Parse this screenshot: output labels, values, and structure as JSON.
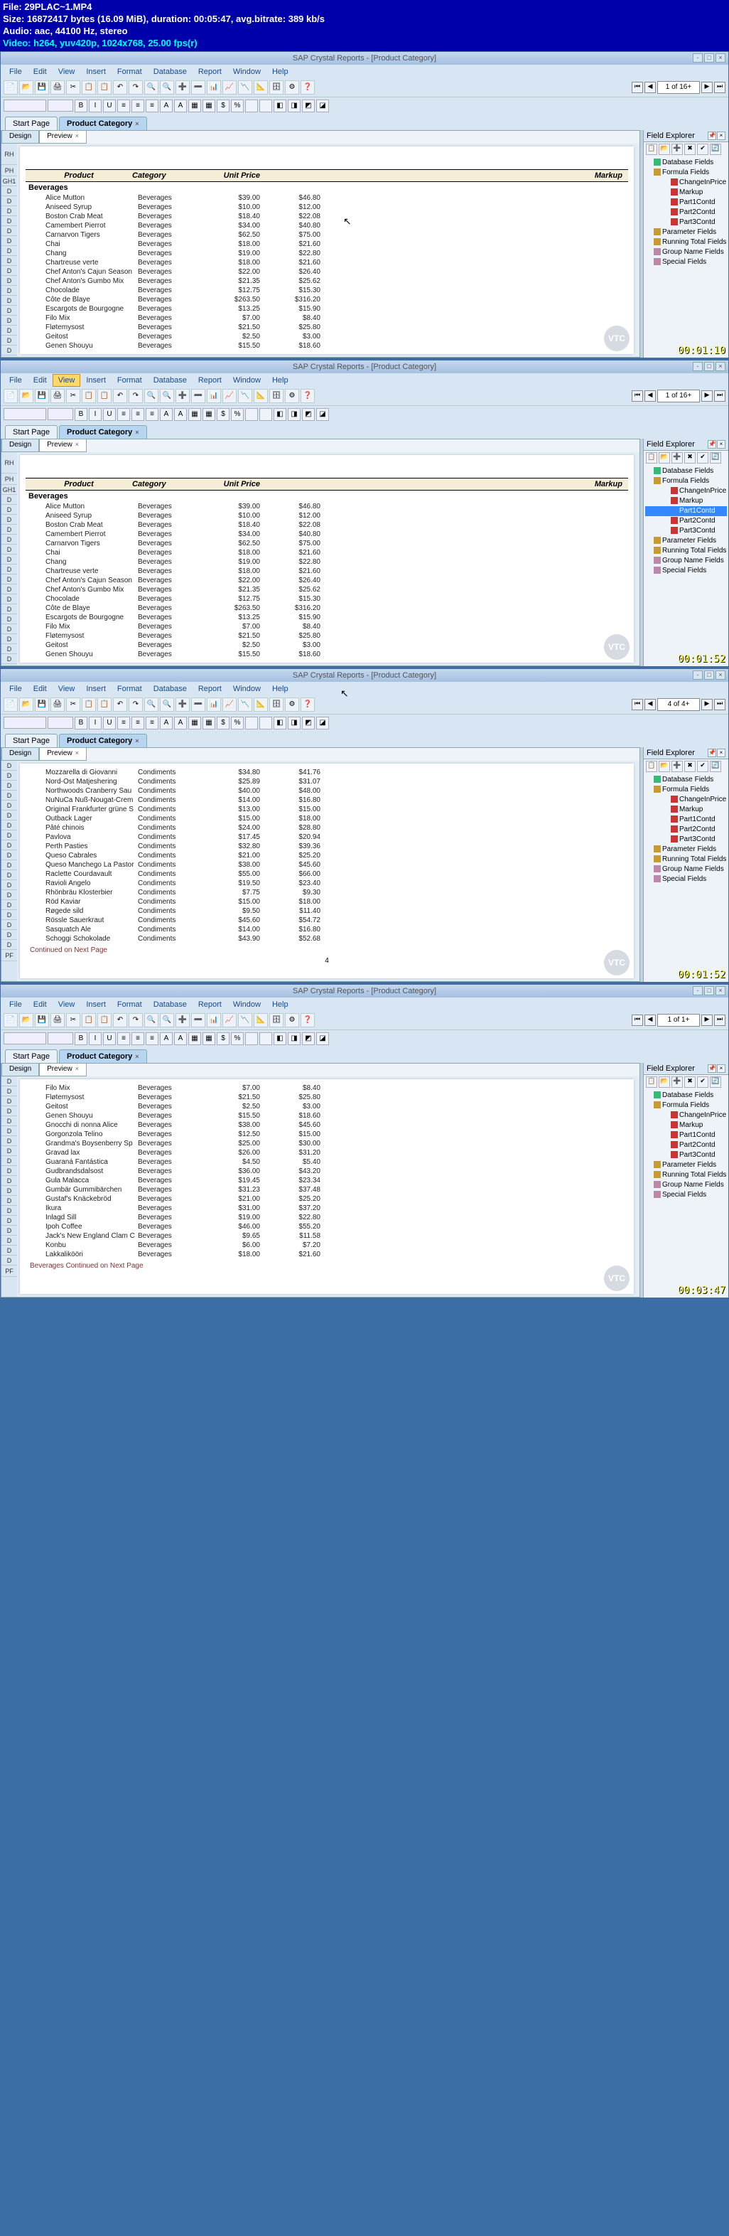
{
  "video": {
    "l1": "File: 29PLAC~1.MP4",
    "l2": "Size: 16872417 bytes (16.09 MiB), duration: 00:05:47, avg.bitrate: 389 kb/s",
    "l3": "Audio: aac, 44100 Hz, stereo",
    "l4": "Video: h264, yuv420p, 1024x768, 25.00 fps(r)"
  },
  "app_title": "SAP Crystal Reports - [Product Category]",
  "menu": {
    "file": "File",
    "edit": "Edit",
    "view": "View",
    "insert": "Insert",
    "format": "Format",
    "database": "Database",
    "report": "Report",
    "window": "Window",
    "help": "Help"
  },
  "tabs": {
    "start": "Start Page",
    "product": "Product Category"
  },
  "subtabs": {
    "design": "Design",
    "preview": "Preview"
  },
  "page_ind": {
    "f1": "1 of 16+",
    "f2": "1 of 16+",
    "f3": "4 of 4+",
    "f4": "1 of 1+"
  },
  "explorer": {
    "title": "Field Explorer",
    "nodes": {
      "db": "Database Fields",
      "formula": "Formula Fields",
      "f_change": "ChangeInPrice",
      "f_markup": "Markup",
      "f_p1": "Part1Contd",
      "f_p2": "Part2Contd",
      "f_p3": "Part3Contd",
      "param": "Parameter Fields",
      "running": "Running Total Fields",
      "group": "Group Name Fields",
      "special": "Special Fields"
    }
  },
  "report_headers": {
    "product": "Product",
    "category": "Category",
    "unitprice": "Unit Price",
    "markup": "Markup"
  },
  "gutter": {
    "rh": "RH",
    "ph": "PH",
    "gh1": "GH1",
    "d": "D",
    "pf": "PF"
  },
  "frame1": {
    "group": "Beverages",
    "rows": [
      {
        "p": "Alice Mutton",
        "c": "Beverages",
        "u": "$39.00",
        "m": "$46.80"
      },
      {
        "p": "Aniseed Syrup",
        "c": "Beverages",
        "u": "$10.00",
        "m": "$12.00"
      },
      {
        "p": "Boston Crab Meat",
        "c": "Beverages",
        "u": "$18.40",
        "m": "$22.08"
      },
      {
        "p": "Camembert Pierrot",
        "c": "Beverages",
        "u": "$34.00",
        "m": "$40.80"
      },
      {
        "p": "Carnarvon Tigers",
        "c": "Beverages",
        "u": "$62.50",
        "m": "$75.00"
      },
      {
        "p": "Chai",
        "c": "Beverages",
        "u": "$18.00",
        "m": "$21.60"
      },
      {
        "p": "Chang",
        "c": "Beverages",
        "u": "$19.00",
        "m": "$22.80"
      },
      {
        "p": "Chartreuse verte",
        "c": "Beverages",
        "u": "$18.00",
        "m": "$21.60"
      },
      {
        "p": "Chef Anton's Cajun Season",
        "c": "Beverages",
        "u": "$22.00",
        "m": "$26.40"
      },
      {
        "p": "Chef Anton's Gumbo Mix",
        "c": "Beverages",
        "u": "$21.35",
        "m": "$25.62"
      },
      {
        "p": "Chocolade",
        "c": "Beverages",
        "u": "$12.75",
        "m": "$15.30"
      },
      {
        "p": "Côte de Blaye",
        "c": "Beverages",
        "u": "$263.50",
        "m": "$316.20"
      },
      {
        "p": "Escargots de Bourgogne",
        "c": "Beverages",
        "u": "$13.25",
        "m": "$15.90"
      },
      {
        "p": "Filo Mix",
        "c": "Beverages",
        "u": "$7.00",
        "m": "$8.40"
      },
      {
        "p": "Fløtemysost",
        "c": "Beverages",
        "u": "$21.50",
        "m": "$25.80"
      },
      {
        "p": "Geitost",
        "c": "Beverages",
        "u": "$2.50",
        "m": "$3.00"
      },
      {
        "p": "Genen Shouyu",
        "c": "Beverages",
        "u": "$15.50",
        "m": "$18.60"
      }
    ],
    "timestamp": "00:01:10"
  },
  "frame2": {
    "group": "Beverages",
    "rows": [
      {
        "p": "Alice Mutton",
        "c": "Beverages",
        "u": "$39.00",
        "m": "$46.80"
      },
      {
        "p": "Aniseed Syrup",
        "c": "Beverages",
        "u": "$10.00",
        "m": "$12.00"
      },
      {
        "p": "Boston Crab Meat",
        "c": "Beverages",
        "u": "$18.40",
        "m": "$22.08"
      },
      {
        "p": "Camembert Pierrot",
        "c": "Beverages",
        "u": "$34.00",
        "m": "$40.80"
      },
      {
        "p": "Carnarvon Tigers",
        "c": "Beverages",
        "u": "$62.50",
        "m": "$75.00"
      },
      {
        "p": "Chai",
        "c": "Beverages",
        "u": "$18.00",
        "m": "$21.60"
      },
      {
        "p": "Chang",
        "c": "Beverages",
        "u": "$19.00",
        "m": "$22.80"
      },
      {
        "p": "Chartreuse verte",
        "c": "Beverages",
        "u": "$18.00",
        "m": "$21.60"
      },
      {
        "p": "Chef Anton's Cajun Season",
        "c": "Beverages",
        "u": "$22.00",
        "m": "$26.40"
      },
      {
        "p": "Chef Anton's Gumbo Mix",
        "c": "Beverages",
        "u": "$21.35",
        "m": "$25.62"
      },
      {
        "p": "Chocolade",
        "c": "Beverages",
        "u": "$12.75",
        "m": "$15.30"
      },
      {
        "p": "Côte de Blaye",
        "c": "Beverages",
        "u": "$263.50",
        "m": "$316.20"
      },
      {
        "p": "Escargots de Bourgogne",
        "c": "Beverages",
        "u": "$13.25",
        "m": "$15.90"
      },
      {
        "p": "Filo Mix",
        "c": "Beverages",
        "u": "$7.00",
        "m": "$8.40"
      },
      {
        "p": "Fløtemysost",
        "c": "Beverages",
        "u": "$21.50",
        "m": "$25.80"
      },
      {
        "p": "Geitost",
        "c": "Beverages",
        "u": "$2.50",
        "m": "$3.00"
      },
      {
        "p": "Genen Shouyu",
        "c": "Beverages",
        "u": "$15.50",
        "m": "$18.60"
      }
    ],
    "timestamp": "00:01:52"
  },
  "frame3": {
    "rows": [
      {
        "p": "Mozzarella di Giovanni",
        "c": "Condiments",
        "u": "$34.80",
        "m": "$41.76"
      },
      {
        "p": "Nord-Ost Matjeshering",
        "c": "Condiments",
        "u": "$25.89",
        "m": "$31.07"
      },
      {
        "p": "Northwoods Cranberry Sau",
        "c": "Condiments",
        "u": "$40.00",
        "m": "$48.00"
      },
      {
        "p": "NuNuCa Nuß-Nougat-Crem",
        "c": "Condiments",
        "u": "$14.00",
        "m": "$16.80"
      },
      {
        "p": "Original Frankfurter grüne S",
        "c": "Condiments",
        "u": "$13.00",
        "m": "$15.00"
      },
      {
        "p": "Outback Lager",
        "c": "Condiments",
        "u": "$15.00",
        "m": "$18.00"
      },
      {
        "p": "Pâté chinois",
        "c": "Condiments",
        "u": "$24.00",
        "m": "$28.80"
      },
      {
        "p": "Pavlova",
        "c": "Condiments",
        "u": "$17.45",
        "m": "$20.94"
      },
      {
        "p": "Perth Pasties",
        "c": "Condiments",
        "u": "$32.80",
        "m": "$39.36"
      },
      {
        "p": "Queso Cabrales",
        "c": "Condiments",
        "u": "$21.00",
        "m": "$25.20"
      },
      {
        "p": "Queso Manchego La Pastor",
        "c": "Condiments",
        "u": "$38.00",
        "m": "$45.60"
      },
      {
        "p": "Raclette Courdavault",
        "c": "Condiments",
        "u": "$55.00",
        "m": "$66.00"
      },
      {
        "p": "Ravioli Angelo",
        "c": "Condiments",
        "u": "$19.50",
        "m": "$23.40"
      },
      {
        "p": "Rhönbräu Klosterbier",
        "c": "Condiments",
        "u": "$7.75",
        "m": "$9.30"
      },
      {
        "p": "Röd Kaviar",
        "c": "Condiments",
        "u": "$15.00",
        "m": "$18.00"
      },
      {
        "p": "Røgede sild",
        "c": "Condiments",
        "u": "$9.50",
        "m": "$11.40"
      },
      {
        "p": "Rössle Sauerkraut",
        "c": "Condiments",
        "u": "$45.60",
        "m": "$54.72"
      },
      {
        "p": "Sasquatch Ale",
        "c": "Condiments",
        "u": "$14.00",
        "m": "$16.80"
      },
      {
        "p": "Schoggi Schokolade",
        "c": "Condiments",
        "u": "$43.90",
        "m": "$52.68"
      }
    ],
    "cont": "Continued on Next Page",
    "page_num": "4",
    "timestamp": "00:01:52"
  },
  "frame4": {
    "rows": [
      {
        "p": "Filo Mix",
        "c": "Beverages",
        "u": "$7.00",
        "m": "$8.40"
      },
      {
        "p": "Fløtemysost",
        "c": "Beverages",
        "u": "$21.50",
        "m": "$25.80"
      },
      {
        "p": "Geitost",
        "c": "Beverages",
        "u": "$2.50",
        "m": "$3.00"
      },
      {
        "p": "Genen Shouyu",
        "c": "Beverages",
        "u": "$15.50",
        "m": "$18.60"
      },
      {
        "p": "Gnocchi di nonna Alice",
        "c": "Beverages",
        "u": "$38.00",
        "m": "$45.60"
      },
      {
        "p": "Gorgonzola Telino",
        "c": "Beverages",
        "u": "$12.50",
        "m": "$15.00"
      },
      {
        "p": "Grandma's Boysenberry Sp",
        "c": "Beverages",
        "u": "$25.00",
        "m": "$30.00"
      },
      {
        "p": "Gravad lax",
        "c": "Beverages",
        "u": "$26.00",
        "m": "$31.20"
      },
      {
        "p": "Guaraná Fantástica",
        "c": "Beverages",
        "u": "$4.50",
        "m": "$5.40"
      },
      {
        "p": "Gudbrandsdalsost",
        "c": "Beverages",
        "u": "$36.00",
        "m": "$43.20"
      },
      {
        "p": "Gula Malacca",
        "c": "Beverages",
        "u": "$19.45",
        "m": "$23.34"
      },
      {
        "p": "Gumbär Gummibärchen",
        "c": "Beverages",
        "u": "$31.23",
        "m": "$37.48"
      },
      {
        "p": "Gustaf's Knäckebröd",
        "c": "Beverages",
        "u": "$21.00",
        "m": "$25.20"
      },
      {
        "p": "Ikura",
        "c": "Beverages",
        "u": "$31.00",
        "m": "$37.20"
      },
      {
        "p": "Inlagd Sill",
        "c": "Beverages",
        "u": "$19.00",
        "m": "$22.80"
      },
      {
        "p": "Ipoh Coffee",
        "c": "Beverages",
        "u": "$46.00",
        "m": "$55.20"
      },
      {
        "p": "Jack's New England Clam C",
        "c": "Beverages",
        "u": "$9.65",
        "m": "$11.58"
      },
      {
        "p": "Konbu",
        "c": "Beverages",
        "u": "$6.00",
        "m": "$7.20"
      },
      {
        "p": "Lakkalikööri",
        "c": "Beverages",
        "u": "$18.00",
        "m": "$21.60"
      }
    ],
    "cont": "Beverages Continued on Next Page",
    "timestamp": "00:03:47"
  }
}
